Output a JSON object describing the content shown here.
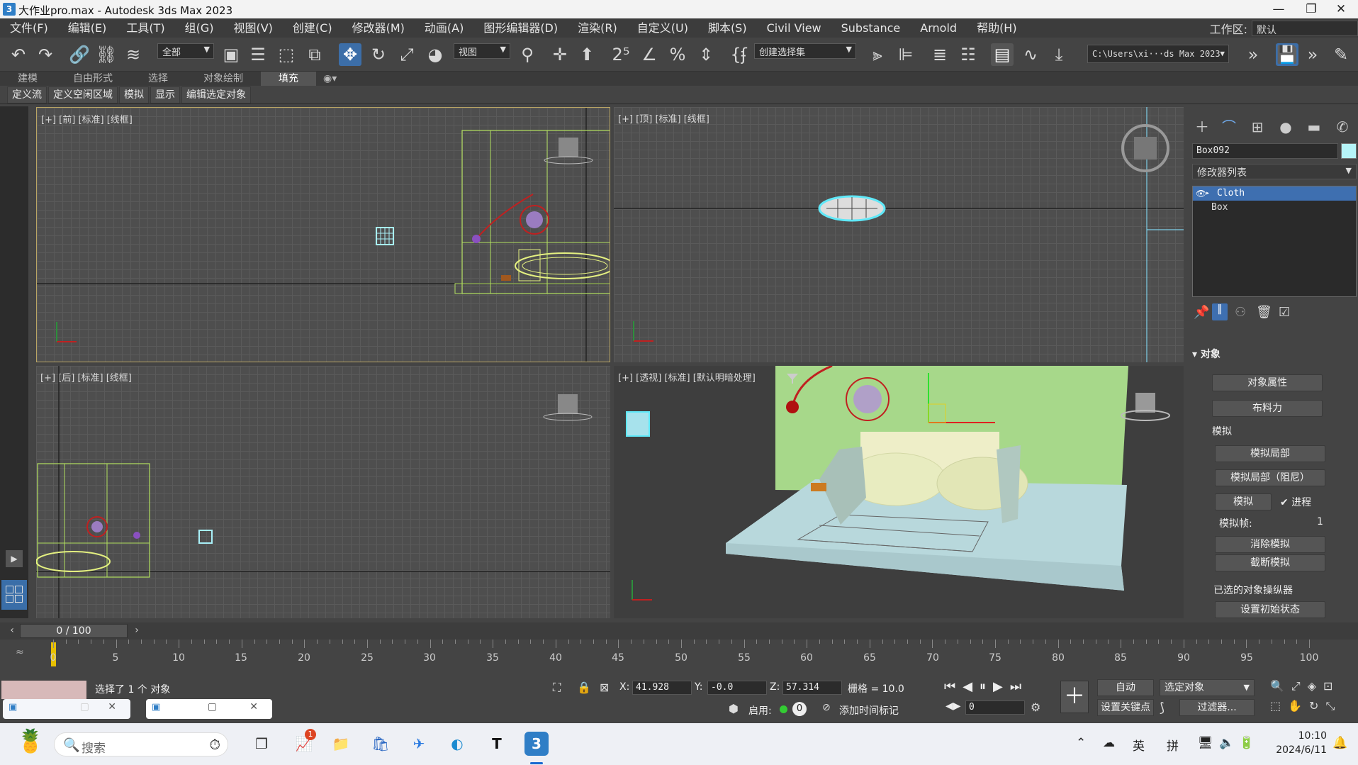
{
  "window": {
    "title": "大作业pro.max - Autodesk 3ds Max 2023",
    "app_icon": "3",
    "minimize": "—",
    "maximize": "❐",
    "close": "✕"
  },
  "menu": {
    "items": [
      "文件(F)",
      "编辑(E)",
      "工具(T)",
      "组(G)",
      "视图(V)",
      "创建(C)",
      "修改器(M)",
      "动画(A)",
      "图形编辑器(D)",
      "渲染(R)",
      "自定义(U)",
      "脚本(S)",
      "Civil View",
      "Substance",
      "Arnold",
      "帮助(H)"
    ],
    "workspace_label": "工作区:",
    "workspace_value": "默认"
  },
  "toolbar": {
    "selection_filter": "全部",
    "ref_coord": "视图",
    "selection_set": "创建选择集",
    "project_path": "C:\\Users\\xi···ds Max 2023"
  },
  "ribbon": {
    "tabs": [
      "建模",
      "自由形式",
      "选择",
      "对象绘制",
      "填充"
    ],
    "active_tab": "填充",
    "sub_buttons": [
      "定义流",
      "定义空闲区域",
      "模拟",
      "显示",
      "编辑选定对象"
    ]
  },
  "viewports": {
    "front": "[+] [前] [标准] [线框]",
    "top": "[+] [顶] [标准] [线框]",
    "back": "[+] [后] [标准] [线框]",
    "perspective": "[+] [透视] [标准] [默认明暗处理]"
  },
  "command_panel": {
    "object_name": "Box092",
    "object_color": "#b6f4f8",
    "modifier_list": "修改器列表",
    "stack": [
      "Cloth",
      "Box"
    ],
    "selected_modifier": "Cloth",
    "rollout_title": "对象",
    "buttons": {
      "object_properties": "对象属性",
      "cloth_forces": "布料力",
      "simulate_local": "模拟局部",
      "simulate_local_damped": "模拟局部（阻尼）",
      "simulate": "模拟",
      "erase_sim": "消除模拟",
      "truncate_sim": "截断模拟",
      "set_initial_state": "设置初始状态"
    },
    "sim_group_label": "模拟",
    "progress_label": "进程",
    "progress_checked": true,
    "sim_frames_label": "模拟帧:",
    "sim_frames_value": "1",
    "selected_manip_label": "已选的对象操纵器"
  },
  "timeline": {
    "frame_display": "0 / 100",
    "ticks": [
      "0",
      "5",
      "10",
      "15",
      "20",
      "25",
      "30",
      "35",
      "40",
      "45",
      "50",
      "55",
      "60",
      "65",
      "70",
      "75",
      "80",
      "85",
      "90",
      "95",
      "100"
    ]
  },
  "status": {
    "selection_text": "选择了 1 个 对象",
    "x_label": "X:",
    "x_value": "41.928",
    "y_label": "Y:",
    "y_value": "-0.0",
    "z_label": "Z:",
    "z_value": "57.314",
    "grid_text": "栅格 = 10.0",
    "enable_label": "启用:",
    "enable_value": "0",
    "add_time_tag": "添加时间标记",
    "auto_key": "自动",
    "key_filter_select": "选定对象",
    "set_key": "设置关键点",
    "filters": "过滤器...",
    "frame_field": "0"
  },
  "taskbar": {
    "search_placeholder": "搜索",
    "badge": "1",
    "lang": "英",
    "ime": "拼",
    "time": "10:10",
    "date": "2024/6/11"
  }
}
